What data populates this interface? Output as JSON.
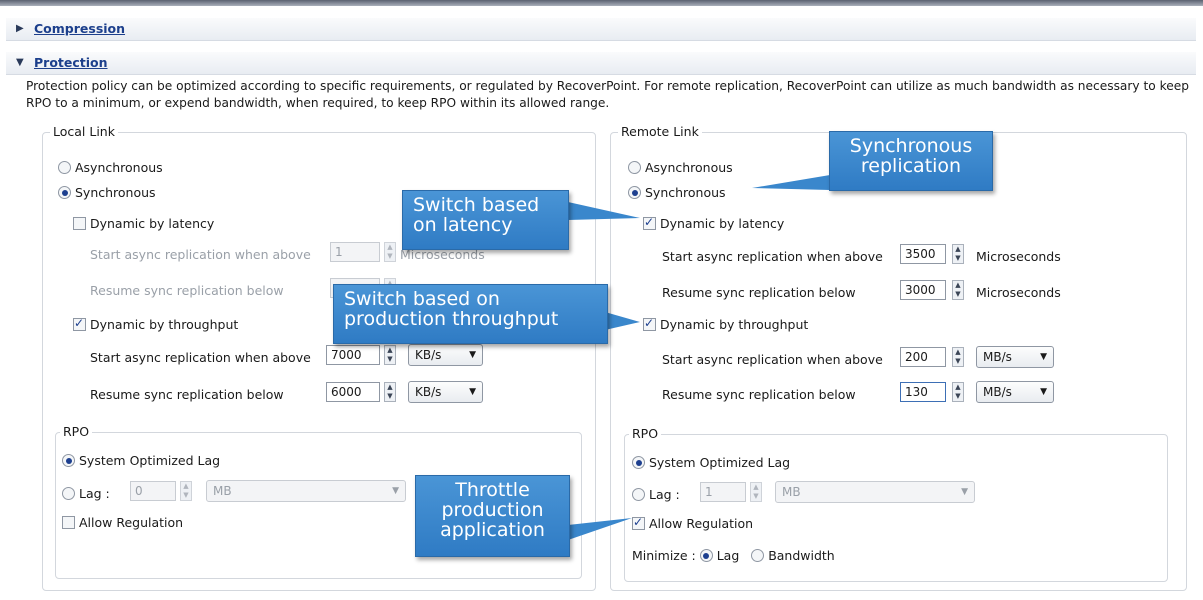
{
  "sections": {
    "compression": {
      "title": "Compression"
    },
    "protection": {
      "title": "Protection",
      "description": "Protection policy can be optimized according to specific requirements, or regulated by RecoverPoint. For remote replication, RecoverPoint can utilize as much bandwidth as necessary to keep RPO to a minimum, or expend bandwidth, when required, to keep RPO within its allowed range."
    }
  },
  "local": {
    "title": "Local Link",
    "async": "Asynchronous",
    "sync": "Synchronous",
    "latency": {
      "label": "Dynamic by latency",
      "start_label": "Start async replication when above",
      "start_value": "1",
      "start_unit": "Microseconds",
      "resume_label": "Resume sync replication below",
      "resume_value": ""
    },
    "throughput": {
      "label": "Dynamic by throughput",
      "start_label": "Start async replication when above",
      "start_value": "7000",
      "start_unit": "KB/s",
      "resume_label": "Resume sync replication below",
      "resume_value": "6000",
      "resume_unit": "KB/s"
    },
    "rpo": {
      "title": "RPO",
      "system": "System Optimized Lag",
      "lag_label": "Lag :",
      "lag_value": "0",
      "lag_unit": "MB",
      "allow": "Allow Regulation"
    }
  },
  "remote": {
    "title": "Remote Link",
    "async": "Asynchronous",
    "sync": "Synchronous",
    "latency": {
      "label": "Dynamic by latency",
      "start_label": "Start async replication when above",
      "start_value": "3500",
      "start_unit": "Microseconds",
      "resume_label": "Resume sync replication below",
      "resume_value": "3000",
      "resume_unit": "Microseconds"
    },
    "throughput": {
      "label": "Dynamic by throughput",
      "start_label": "Start async replication when above",
      "start_value": "200",
      "start_unit": "MB/s",
      "resume_label": "Resume sync replication below",
      "resume_value": "130",
      "resume_unit": "MB/s"
    },
    "rpo": {
      "title": "RPO",
      "system": "System Optimized Lag",
      "lag_label": "Lag :",
      "lag_value": "1",
      "lag_unit": "MB",
      "allow": "Allow Regulation",
      "minimize_label": "Minimize :",
      "minimize_lag": "Lag",
      "minimize_bandwidth": "Bandwidth"
    }
  },
  "callouts": {
    "sync_rep": "Synchronous replication",
    "latency": "Switch based on latency",
    "throughput": "Switch based on production throughput",
    "throttle": "Throttle production application"
  },
  "colors": {
    "callout": "#3a87cc",
    "link": "#1c3f8c"
  }
}
